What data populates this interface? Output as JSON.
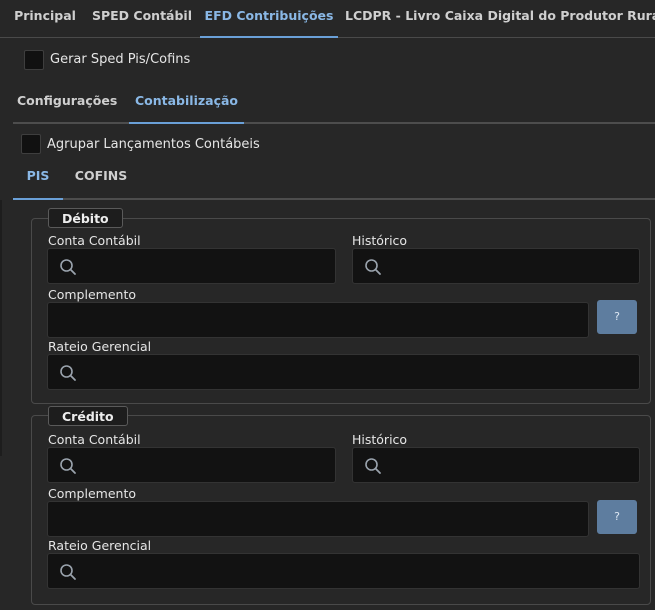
{
  "tabs": {
    "principal": "Principal",
    "sped_contabil": "SPED Contábil",
    "efd_contribuicoes": "EFD Contribuições",
    "lcdpr": "LCDPR - Livro Caixa Digital do Produtor Rural"
  },
  "gerar_sped": {
    "label": "Gerar Sped Pis/Cofins",
    "checked": false
  },
  "subtabs": {
    "configuracoes": "Configurações",
    "contabilizacao": "Contabilização"
  },
  "agrupar": {
    "label": "Agrupar Lançamentos Contábeis",
    "checked": false
  },
  "tax_tabs": {
    "pis": "PIS",
    "cofins": "COFINS"
  },
  "debito": {
    "legend": "Débito",
    "conta_contabil_label": "Conta Contábil",
    "historico_label": "Histórico",
    "complemento_label": "Complemento",
    "rateio_label": "Rateio Gerencial",
    "help_label": "?"
  },
  "credito": {
    "legend": "Crédito",
    "conta_contabil_label": "Conta Contábil",
    "historico_label": "Histórico",
    "complemento_label": "Complemento",
    "rateio_label": "Rateio Gerencial",
    "help_label": "?"
  },
  "icons": {
    "search": "search-icon"
  },
  "colors": {
    "accent": "#8ab8e6",
    "help_button": "#5e7d9f"
  }
}
